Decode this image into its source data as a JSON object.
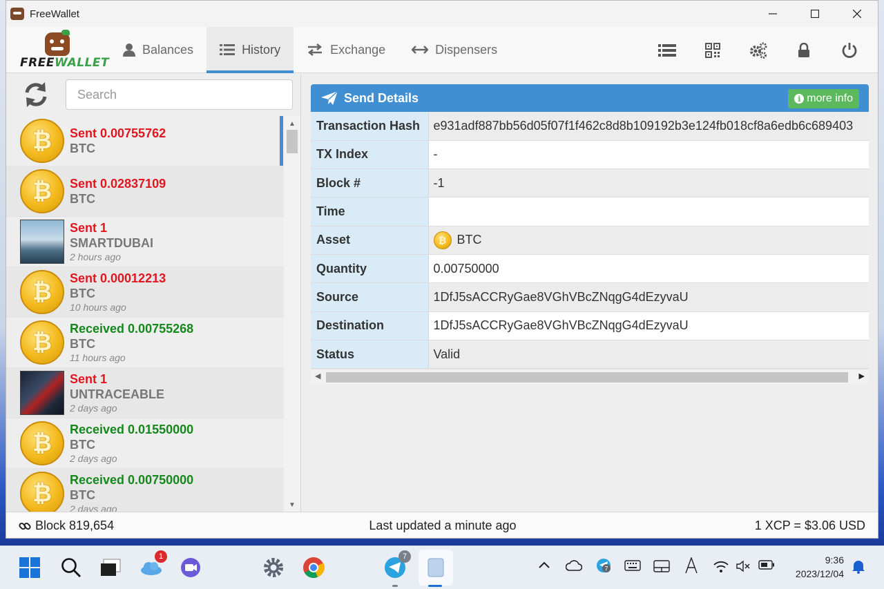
{
  "window": {
    "title": "FreeWallet",
    "controls": {
      "minimize": "—",
      "maximize": "☐",
      "close": "✕"
    }
  },
  "logo": {
    "free": "FREE",
    "wallet": "WALLET"
  },
  "nav": {
    "tabs": [
      {
        "label": "Balances",
        "icon": "user-icon"
      },
      {
        "label": "History",
        "icon": "list-icon",
        "active": true
      },
      {
        "label": "Exchange",
        "icon": "exchange-arrows-icon"
      },
      {
        "label": "Dispensers",
        "icon": "left-right-arrow-icon"
      }
    ],
    "right_icons": [
      "list-icon",
      "qrcode-icon",
      "gears-icon",
      "lock-icon",
      "power-icon"
    ]
  },
  "search": {
    "placeholder": "Search"
  },
  "history": [
    {
      "direction": "Sent",
      "amount": "Sent 0.00755762",
      "asset": "BTC",
      "time": "",
      "icon": "bitcoin-coin"
    },
    {
      "direction": "Sent",
      "amount": "Sent 0.02837109",
      "asset": "BTC",
      "time": "",
      "icon": "bitcoin-coin"
    },
    {
      "direction": "Sent",
      "amount": "Sent 1",
      "asset": "SMARTDUBAI",
      "time": "2 hours ago",
      "icon": "asset-image-dubai"
    },
    {
      "direction": "Sent",
      "amount": "Sent 0.00012213",
      "asset": "BTC",
      "time": "10 hours ago",
      "icon": "bitcoin-coin"
    },
    {
      "direction": "Received",
      "amount": "Received 0.00755268",
      "asset": "BTC",
      "time": "11 hours ago",
      "icon": "bitcoin-coin"
    },
    {
      "direction": "Sent",
      "amount": "Sent 1",
      "asset": "UNTRACEABLE",
      "time": "2 days ago",
      "icon": "asset-image-untraceable"
    },
    {
      "direction": "Received",
      "amount": "Received 0.01550000",
      "asset": "BTC",
      "time": "2 days ago",
      "icon": "bitcoin-coin"
    },
    {
      "direction": "Received",
      "amount": "Received 0.00750000",
      "asset": "BTC",
      "time": "2 days ago",
      "icon": "bitcoin-coin"
    }
  ],
  "details": {
    "title": "Send Details",
    "more_info": "more info",
    "rows": [
      {
        "key": "Transaction Hash",
        "value": "e931adf887bb56d05f07f1f462c8d8b109192b3e124fb018cf8a6edb6c689403"
      },
      {
        "key": "TX Index",
        "value": "-"
      },
      {
        "key": "Block #",
        "value": "-1"
      },
      {
        "key": "Time",
        "value": ""
      },
      {
        "key": "Asset",
        "value": "BTC"
      },
      {
        "key": "Quantity",
        "value": "0.00750000"
      },
      {
        "key": "Source",
        "value": "1DfJ5sACCRyGae8VGhVBcZNqgG4dEzyvaU"
      },
      {
        "key": "Destination",
        "value": "1DfJ5sACCRyGae8VGhVBcZNqgG4dEzyvaU"
      },
      {
        "key": "Status",
        "value": "Valid"
      }
    ]
  },
  "statusbar": {
    "block": "Block 819,654",
    "updated": "Last updated a minute ago",
    "price": "1 XCP = $3.06 USD"
  },
  "taskbar": {
    "weather_badge": "1",
    "telegram_badge": "7",
    "tray_telegram_badge": "7",
    "time": "9:36",
    "date": "2023/12/04"
  },
  "colors": {
    "accent": "#3f8fd2",
    "sent": "#e0171f",
    "received": "#15881c",
    "more_info": "#5cb85c"
  }
}
